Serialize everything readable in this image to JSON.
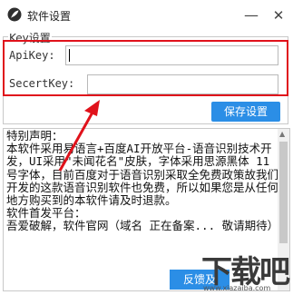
{
  "window": {
    "title": "软件设置",
    "minimize_glyph": "—",
    "close_glyph": "✕"
  },
  "group": {
    "title": "Key设置"
  },
  "fields": {
    "apikey_label": "ApiKey:",
    "apikey_value": "",
    "secret_label": "SecertKey:",
    "secret_value": ""
  },
  "buttons": {
    "save": "保存设置",
    "feedback": "反馈及"
  },
  "notes": {
    "text": "特别声明：\n本软件采用易语言+百度AI开放平台-语音识别技术开发，UI采用\"未闻花名\"皮肤，字体采用思源黑体 11号字体，目前百度对于语音识别采取全免费政策故我们开发的这款语音识别软件也免费，所以如果您是从任何地方购买到的本软件请及时退款。\n软件首发平台：\n吾爱破解，软件官网（域名 正在备案... 敬请期待）"
  },
  "watermark": {
    "logo": "下载吧",
    "url": "www.xiazaiba.com"
  },
  "colors": {
    "accent": "#2b8ee6",
    "highlight": "#e0121b"
  }
}
